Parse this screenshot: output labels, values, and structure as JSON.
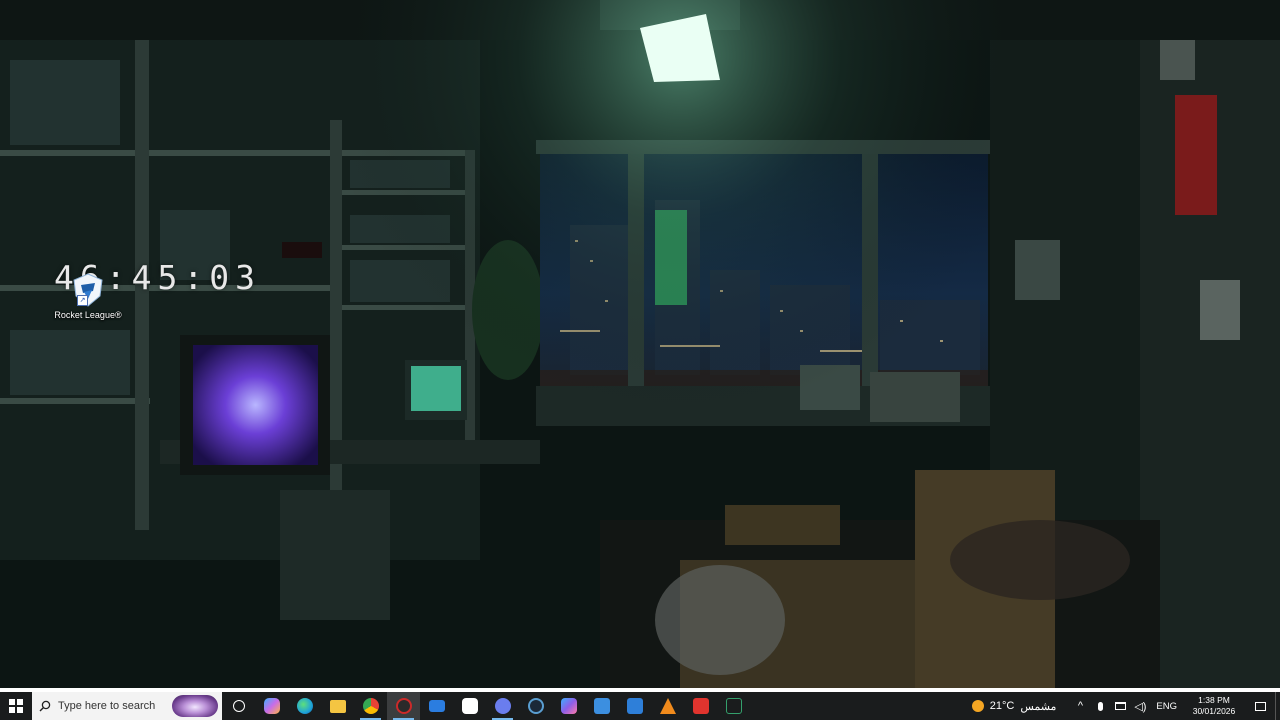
{
  "desktop": {
    "clock_widget": "46:45:03",
    "icons": [
      {
        "label": "Rocket League®",
        "icon": "rocket-league-icon"
      }
    ]
  },
  "taskbar": {
    "search_placeholder": "Type here to search",
    "pinned": [
      {
        "name": "cortana-button",
        "icon": "circle-icon"
      },
      {
        "name": "copilot-button",
        "icon": "copilot-icon",
        "color": "#c86ce8"
      },
      {
        "name": "edge-button",
        "icon": "edge-icon",
        "color": "#1fa3d8"
      },
      {
        "name": "file-explorer-button",
        "icon": "folder-icon",
        "color": "#f4c542"
      },
      {
        "name": "chrome-button",
        "icon": "chrome-icon",
        "color": "#e94235"
      },
      {
        "name": "active-app-button",
        "icon": "app-icon",
        "color": "#cc2a2a"
      },
      {
        "name": "mail-button",
        "icon": "mail-icon",
        "color": "#2b7de0"
      },
      {
        "name": "capcut-button",
        "icon": "capcut-icon",
        "color": "#ffffff"
      },
      {
        "name": "discord-button",
        "icon": "discord-icon",
        "color": "#6a7dee"
      },
      {
        "name": "steam-button",
        "icon": "steam-icon",
        "color": "#5a9ed1"
      },
      {
        "name": "m365-button",
        "icon": "m365-icon",
        "color": "#8d5ee8"
      },
      {
        "name": "app-blue-button",
        "icon": "window-icon",
        "color": "#3c8fe0"
      },
      {
        "name": "app-blue2-button",
        "icon": "window-icon",
        "color": "#2e7fd9"
      },
      {
        "name": "vlc-button",
        "icon": "vlc-icon",
        "color": "#f08a1c"
      },
      {
        "name": "game-launcher-button",
        "icon": "launcher-icon",
        "color": "#e0342e"
      },
      {
        "name": "excel-button",
        "icon": "excel-icon",
        "color": "#34a06c"
      }
    ],
    "weather": {
      "temp": "21°C",
      "condition": "مشمس"
    },
    "language": "ENG",
    "time": "1:38 PM",
    "date": "30/01/2026"
  }
}
